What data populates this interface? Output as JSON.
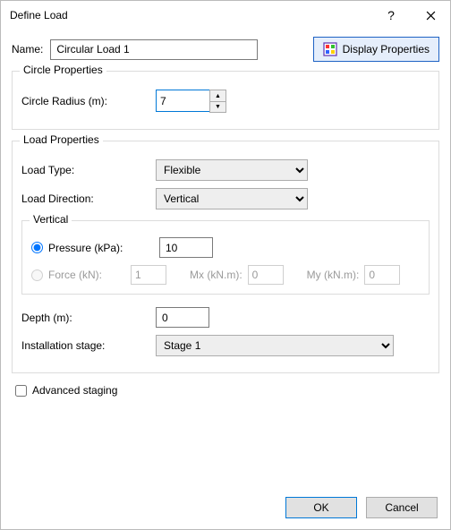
{
  "title": "Define Load",
  "name_label": "Name:",
  "name_value": "Circular Load 1",
  "display_properties_label": "Display Properties",
  "circle_props": {
    "legend": "Circle Properties",
    "radius_label": "Circle Radius (m):",
    "radius_value": "7"
  },
  "load_props": {
    "legend": "Load Properties",
    "load_type_label": "Load Type:",
    "load_type_value": "Flexible",
    "load_direction_label": "Load Direction:",
    "load_direction_value": "Vertical",
    "vertical_legend": "Vertical",
    "pressure_label": "Pressure (kPa):",
    "pressure_value": "10",
    "force_label": "Force (kN):",
    "force_value": "1",
    "mx_label": "Mx (kN.m):",
    "mx_value": "0",
    "my_label": "My (kN.m):",
    "my_value": "0",
    "depth_label": "Depth (m):",
    "depth_value": "0",
    "install_label": "Installation stage:",
    "install_value": "Stage 1"
  },
  "advanced_staging_label": "Advanced staging",
  "ok_label": "OK",
  "cancel_label": "Cancel"
}
